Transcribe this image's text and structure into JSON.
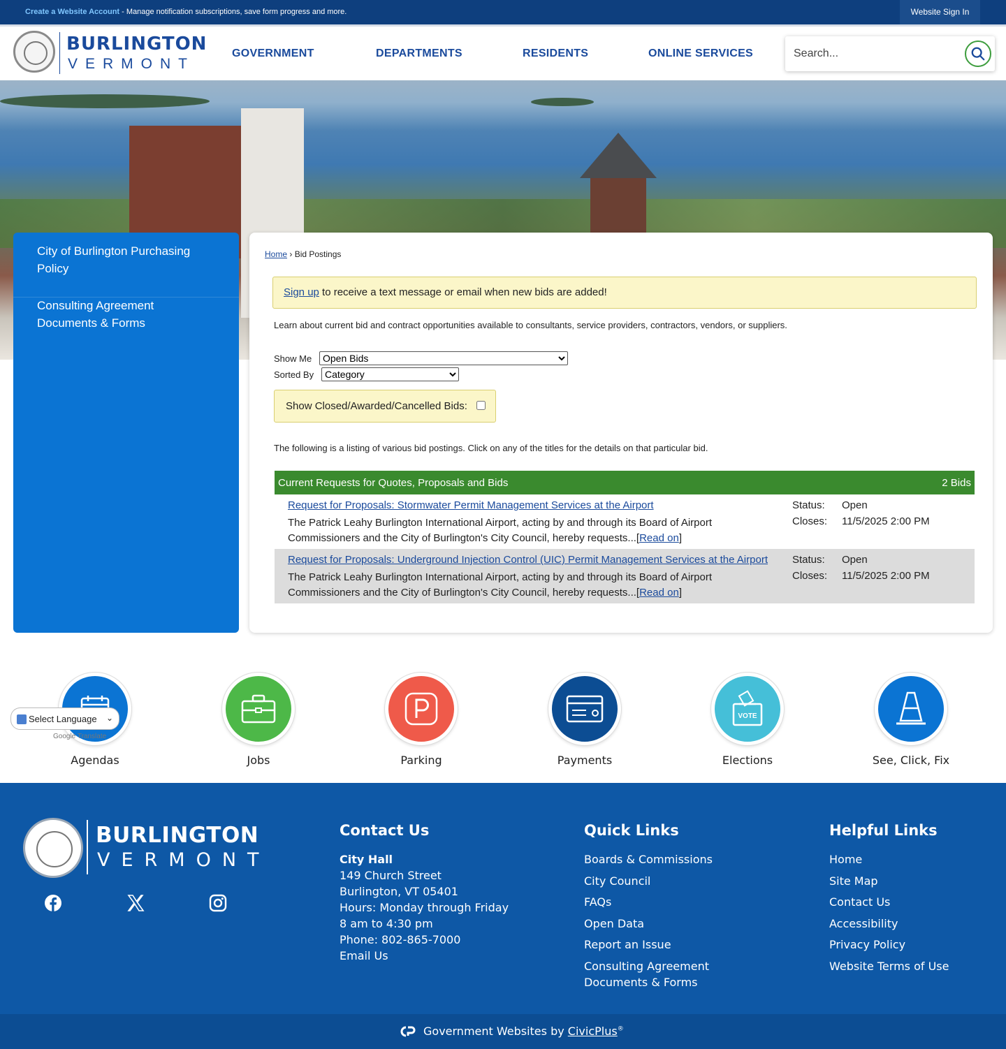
{
  "topbar": {
    "create_account": "Create a Website Account",
    "message": " - Manage notification subscriptions, save form progress and more.",
    "sign_in": "Website Sign In"
  },
  "header": {
    "logo_title": "BURLINGTON",
    "logo_sub": "VERMONT",
    "nav": [
      "GOVERNMENT",
      "DEPARTMENTS",
      "RESIDENTS",
      "ONLINE SERVICES"
    ],
    "search_placeholder": "Search..."
  },
  "sidebar": {
    "items": [
      "City of Burlington Purchasing Policy",
      "Consulting Agreement Documents & Forms"
    ]
  },
  "breadcrumb": {
    "home": "Home",
    "separator": " › ",
    "current": "Bid Postings"
  },
  "notice": {
    "link": "Sign up",
    "text": " to receive a text message or email when new bids are added!"
  },
  "intro": "Learn about current bid and contract opportunities available to consultants, service providers, contractors, vendors, or suppliers.",
  "filters": {
    "show_me_label": "Show Me",
    "show_me_value": "Open Bids",
    "sorted_by_label": "Sorted By",
    "sorted_by_value": "Category",
    "closed_label": "Show Closed/Awarded/Cancelled Bids:"
  },
  "listing_text": "The following is a listing of various bid postings. Click on any of the titles for the details on that particular bid.",
  "category": {
    "title": "Current Requests for Quotes, Proposals and Bids",
    "count": "2 Bids"
  },
  "bids": [
    {
      "title": "Request for Proposals: Stormwater Permit Management Services at the Airport",
      "desc": "The Patrick Leahy Burlington International Airport, acting by and through its Board of Airport Commissioners and the City of Burlington's City Council, hereby requests...",
      "read_on": "Read on",
      "status_label": "Status:",
      "status": "Open",
      "closes_label": "Closes:",
      "closes": "11/5/2025 2:00 PM"
    },
    {
      "title": "Request for Proposals: Underground Injection Control (UIC) Permit Management Services at the Airport",
      "desc": "The Patrick Leahy Burlington International Airport, acting by and through its Board of Airport Commissioners and the City of Burlington's City Council, hereby requests...",
      "read_on": "Read on",
      "status_label": "Status:",
      "status": "Open",
      "closes_label": "Closes:",
      "closes": "11/5/2025 2:00 PM"
    }
  ],
  "quick_links": [
    {
      "label": "Agendas",
      "icon": "calendar-icon",
      "color": "#0b74d3"
    },
    {
      "label": "Jobs",
      "icon": "briefcase-icon",
      "color": "#4db848"
    },
    {
      "label": "Parking",
      "icon": "parking-icon",
      "color": "#ef5a4a"
    },
    {
      "label": "Payments",
      "icon": "credit-card-icon",
      "color": "#0c4d93"
    },
    {
      "label": "Elections",
      "icon": "ballot-box-icon",
      "color": "#45bfd8",
      "icon_text": "VOTE"
    },
    {
      "label": "See, Click, Fix",
      "icon": "traffic-cone-icon",
      "color": "#0b74d3"
    }
  ],
  "translate": {
    "label": "Select Language",
    "powered": "Google Translate"
  },
  "footer": {
    "logo_title": "BURLINGTON",
    "logo_sub": "VERMONT",
    "contact_heading": "Contact Us",
    "contact": {
      "name": "City Hall",
      "address1": "149 Church Street",
      "address2": "Burlington, VT 05401",
      "hours1": "Hours: Monday through Friday",
      "hours2": "8 am to 4:30 pm",
      "phone": "Phone: 802-865-7000",
      "email": "Email Us"
    },
    "quick_heading": "Quick Links",
    "quick": [
      "Boards & Commissions",
      "City Council",
      "FAQs",
      "Open Data",
      "Report an Issue",
      "Consulting Agreement Documents & Forms"
    ],
    "helpful_heading": "Helpful Links",
    "helpful": [
      "Home",
      "Site Map",
      "Contact Us",
      "Accessibility",
      "Privacy Policy",
      "Website Terms of Use"
    ],
    "social": [
      "facebook-icon",
      "x-icon",
      "instagram-icon"
    ]
  },
  "subfooter": {
    "text": "Government Websites by ",
    "link": "CivicPlus",
    "reg": "®"
  },
  "colors": {
    "brand_blue": "#1a4a9c",
    "sidebar_blue": "#0b74d3",
    "footer_blue": "#0e58a6",
    "category_green": "#3a8a2e",
    "notice_yellow": "#fbf6c9"
  }
}
